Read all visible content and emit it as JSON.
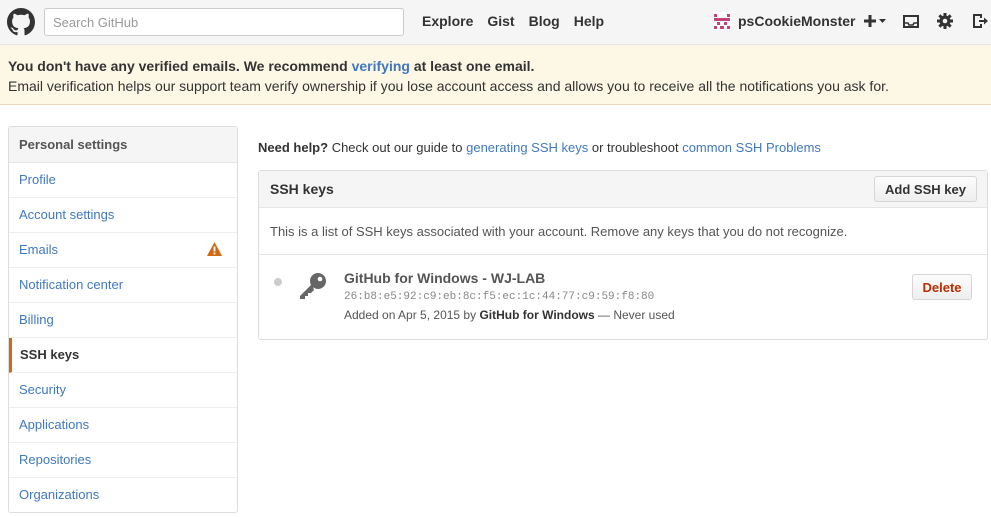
{
  "header": {
    "search_placeholder": "Search GitHub",
    "nav": [
      "Explore",
      "Gist",
      "Blog",
      "Help"
    ],
    "username": "psCookieMonster"
  },
  "flash": {
    "line1_prefix": "You don't have any verified emails. We recommend ",
    "line1_link": "verifying",
    "line1_suffix": " at least one email.",
    "line2": "Email verification helps our support team verify ownership if you lose account access and allows you to receive all the notifications you ask for."
  },
  "sidebar": {
    "heading": "Personal settings",
    "items": [
      {
        "label": "Profile"
      },
      {
        "label": "Account settings"
      },
      {
        "label": "Emails"
      },
      {
        "label": "Notification center"
      },
      {
        "label": "Billing"
      },
      {
        "label": "SSH keys"
      },
      {
        "label": "Security"
      },
      {
        "label": "Applications"
      },
      {
        "label": "Repositories"
      },
      {
        "label": "Organizations"
      }
    ]
  },
  "help": {
    "bold": "Need help?",
    "text1": " Check out our guide to ",
    "link1": "generating SSH keys",
    "text2": " or troubleshoot ",
    "link2": "common SSH Problems"
  },
  "panel": {
    "title": "SSH keys",
    "add_button": "Add SSH key",
    "description": "This is a list of SSH keys associated with your account. Remove any keys that you do not recognize.",
    "key": {
      "title": "GitHub for Windows - WJ-LAB",
      "fingerprint": "26:b8:e5:92:c9:eb:8c:f5:ec:1c:44:77:c9:59:f8:80",
      "added_prefix": "Added on Apr 5, 2015 by ",
      "added_by": "GitHub for Windows",
      "added_suffix": " — Never used",
      "delete_button": "Delete"
    }
  },
  "colors": {
    "link": "#4078c0",
    "flash_bg": "#fdf7e5",
    "selected_bar": "#d26911",
    "delete_text": "#bd2c00"
  }
}
